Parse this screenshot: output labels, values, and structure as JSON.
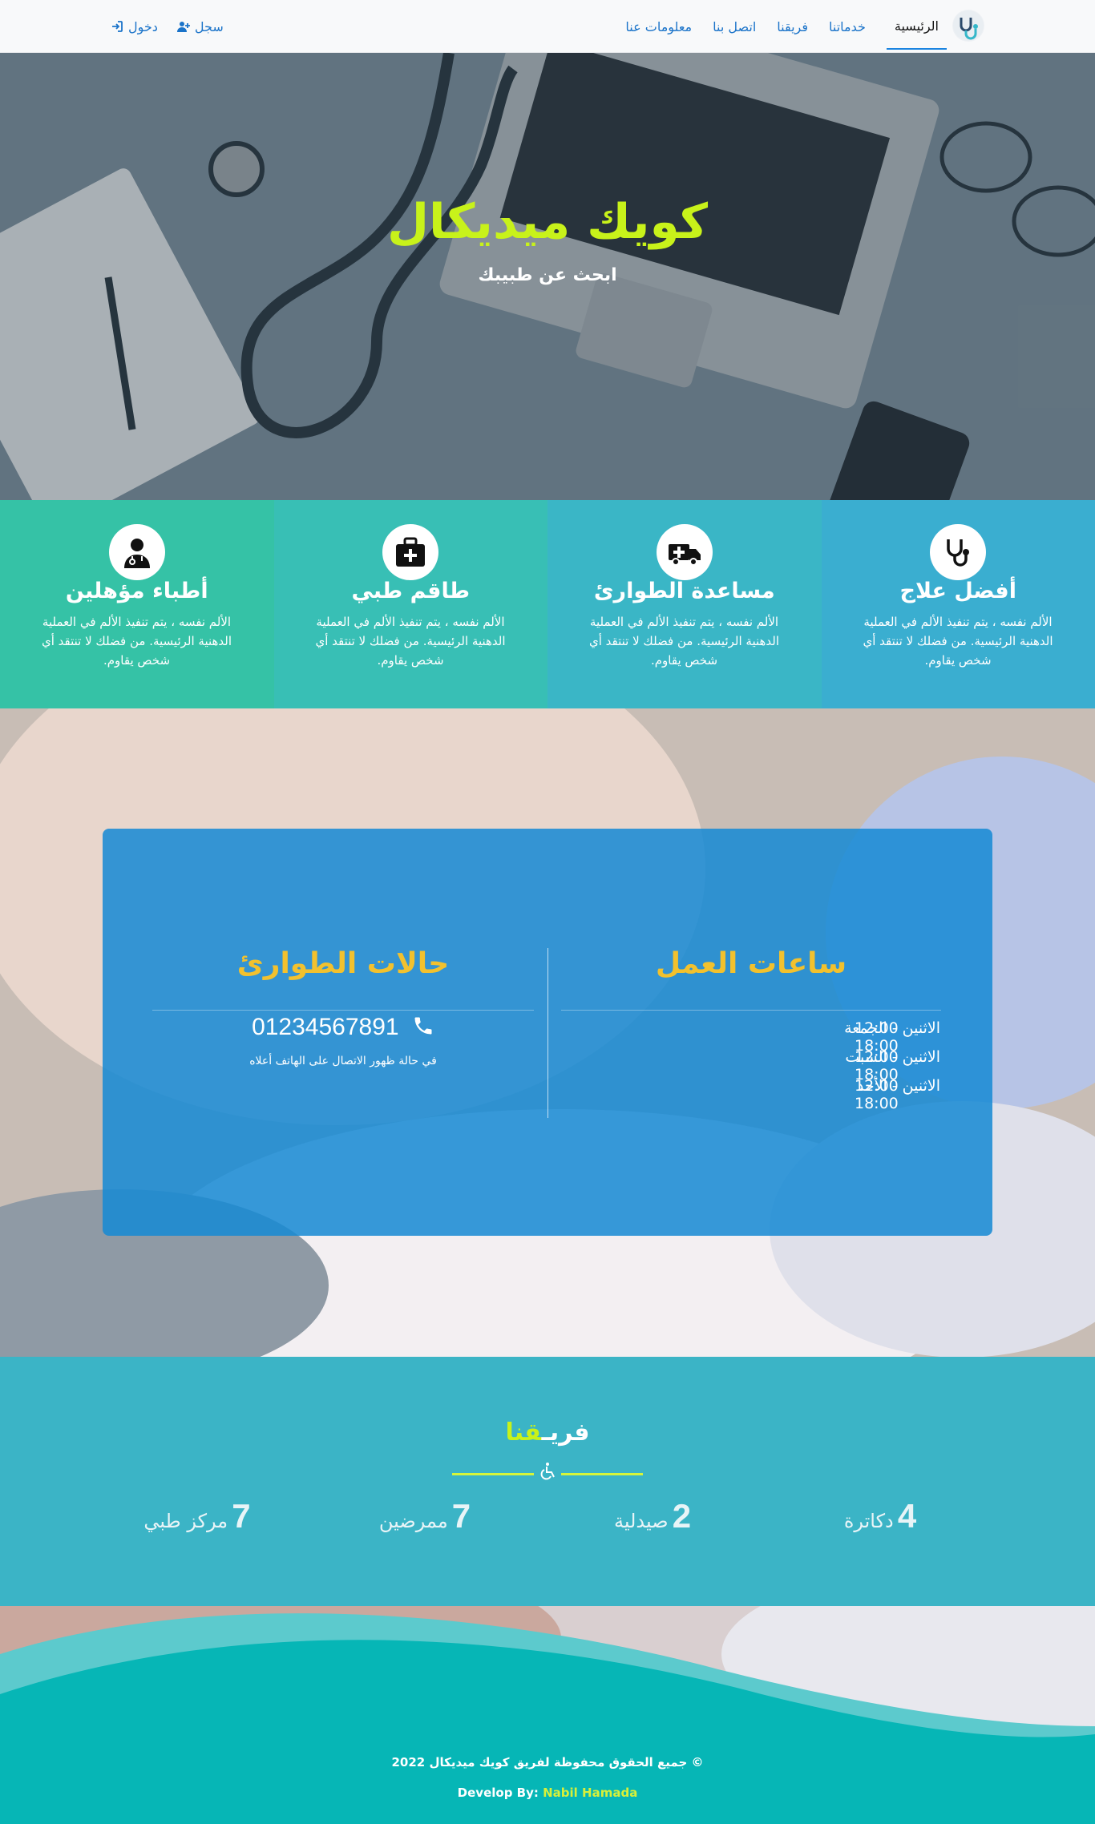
{
  "nav": {
    "brand_icon": "stethoscope-logo-icon",
    "links": [
      "الرئيسية",
      "خدماتنا",
      "فريقنا",
      "اتصل بنا",
      "معلومات عنا"
    ],
    "active_index": 0,
    "register": "سجل",
    "login": "دخول",
    "link_color": "#1a73c9"
  },
  "hero": {
    "title": "كويك ميديكال",
    "subtitle": "ابحث عن طبيبك",
    "title_color": "#c8f21a"
  },
  "features": [
    {
      "icon": "stethoscope-icon",
      "title": "أفضل علاج",
      "text": "الألم نفسه ، يتم تنفيذ الألم في العملية الدهنية الرئيسية. من فضلك لا تنتقد أي شخص يقاوم.",
      "color": "#3aaed0"
    },
    {
      "icon": "ambulance-icon",
      "title": "مساعدة الطوارئ",
      "text": "الألم نفسه ، يتم تنفيذ الألم في العملية الدهنية الرئيسية. من فضلك لا تنتقد أي شخص يقاوم.",
      "color": "#3ab6c6"
    },
    {
      "icon": "medical-kit-icon",
      "title": "طاقم طبي",
      "text": "الألم نفسه ، يتم تنفيذ الألم في العملية الدهنية الرئيسية. من فضلك لا تنتقد أي شخص يقاوم.",
      "color": "#38bfb5"
    },
    {
      "icon": "doctor-icon",
      "title": "أطباء مؤهلين",
      "text": "الألم نفسه ، يتم تنفيذ الألم في العملية الدهنية الرئيسية. من فضلك لا تنتقد أي شخص يقاوم.",
      "color": "#35c2a6"
    }
  ],
  "hours": {
    "title": "ساعات العمل",
    "rows": [
      {
        "day": "الاثنين - الجمعة",
        "time": "12:00 18:00"
      },
      {
        "day": "الاثنين - السبت",
        "time": "12:00 18:00"
      },
      {
        "day": "الاثنين - الأحد",
        "time": "12:00 18:00"
      }
    ]
  },
  "emergency": {
    "title": "حالات الطوارئ",
    "phone": "01234567891",
    "note": "في حالة ظهور الاتصال على الهاتف أعلاه",
    "title_color": "#f2c12e"
  },
  "team": {
    "title_main": "فريـ",
    "title_accent": "قنا",
    "divider_icon": "wheelchair-icon",
    "stats": [
      {
        "num": "4",
        "label": "دكاترة"
      },
      {
        "num": "2",
        "label": "صيدلية"
      },
      {
        "num": "7",
        "label": "ممرضين"
      },
      {
        "num": "7",
        "label": "مركز طبي"
      }
    ]
  },
  "footer": {
    "copyright": "© جميع الحقوق محفوظة لفريق كويك ميديكال 2022",
    "dev_label": "Develop By:",
    "dev_name": "Nabil Hamada"
  }
}
